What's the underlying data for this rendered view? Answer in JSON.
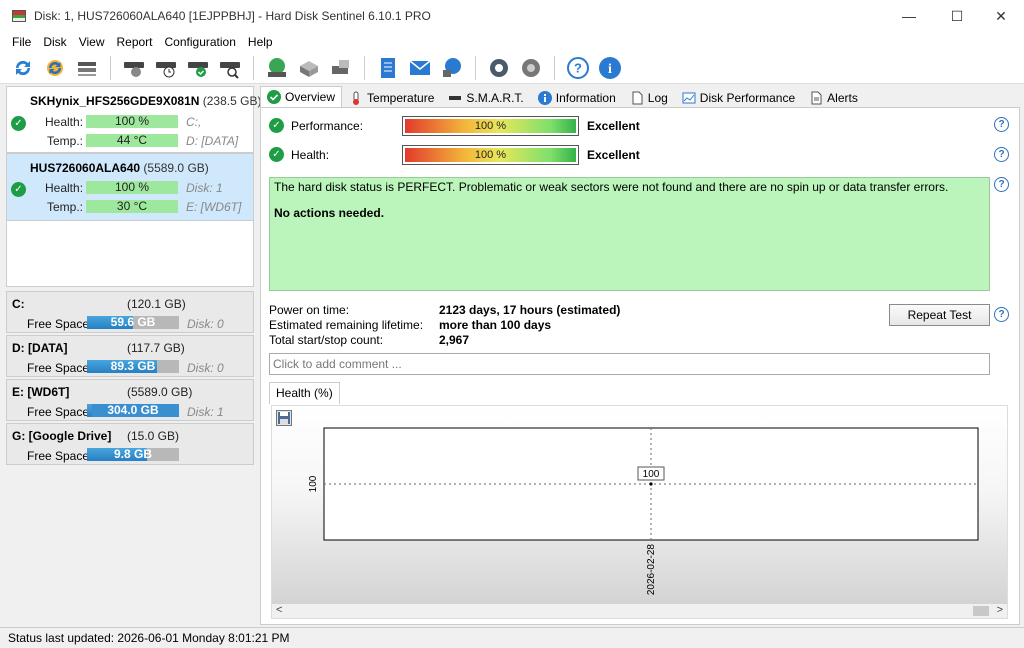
{
  "window": {
    "title": "Disk: 1, HUS726060ALA640 [1EJPPBHJ]  -  Hard Disk Sentinel 6.10.1 PRO",
    "minimize": "—",
    "maximize": "☐",
    "close": "✕"
  },
  "menu": [
    "File",
    "Disk",
    "View",
    "Report",
    "Configuration",
    "Help"
  ],
  "toolbar_icons": [
    "refresh-icon",
    "refresh-all-icon",
    "disk-list-icon",
    "disk-test-icon",
    "disk-timer-icon",
    "disk-check-icon",
    "disk-search-icon",
    "globe-disk-icon",
    "disk-tools-icon",
    "disk-config-icon",
    "report-icon",
    "email-icon",
    "network-icon",
    "settings-icon",
    "sound-icon",
    "help-icon",
    "info-icon"
  ],
  "disks": [
    {
      "name": "SKHynix_HFS256GDE9X081N",
      "size": "(238.5 GB)",
      "extra": "Di",
      "health_label": "Health:",
      "health": "100 %",
      "health_level": 1.0,
      "health_right": "C:,",
      "temp_label": "Temp.:",
      "temp": "44 °C",
      "temp_level": 1.0,
      "temp_right": "D: [DATA]"
    },
    {
      "name": "HUS726060ALA640",
      "size": "(5589.0 GB)",
      "extra": "",
      "health_label": "Health:",
      "health": "100 %",
      "health_level": 1.0,
      "health_right": "Disk: 1",
      "temp_label": "Temp.:",
      "temp": "30 °C",
      "temp_level": 1.0,
      "temp_right": "E: [WD6T]"
    }
  ],
  "volumes": [
    {
      "name": "C:",
      "size": "(120.1 GB)",
      "free_label": "Free Space",
      "free": "59.6 GB",
      "free_frac": 0.5,
      "disk": "Disk: 0"
    },
    {
      "name": "D: [DATA]",
      "size": "(117.7 GB)",
      "free_label": "Free Space",
      "free": "89.3 GB",
      "free_frac": 0.76,
      "disk": "Disk: 0"
    },
    {
      "name": "E: [WD6T]",
      "size": "(5589.0 GB)",
      "free_label": "Free Space",
      "free": "304.0 GB",
      "free_frac": 0.05,
      "disk": "Disk: 1"
    },
    {
      "name": "G: [Google Drive]",
      "size": "(15.0 GB)",
      "free_label": "Free Space",
      "free": "9.8 GB",
      "free_frac": 0.65,
      "disk": ""
    }
  ],
  "tabs": [
    "Overview",
    "Temperature",
    "S.M.A.R.T.",
    "Information",
    "Log",
    "Disk Performance",
    "Alerts"
  ],
  "overview": {
    "performance_label": "Performance:",
    "performance_pct": "100 %",
    "performance_level": 1.0,
    "performance_value": "Excellent",
    "health_label": "Health:",
    "health_pct": "100 %",
    "health_level": 1.0,
    "health_value": "Excellent",
    "status_message": "The hard disk status is PERFECT. Problematic or weak sectors were not found and there are no spin up or data transfer errors.",
    "status_action": "No actions needed.",
    "power_on_label": "Power on time:",
    "power_on_value": "2123 days, 17 hours (estimated)",
    "lifetime_label": "Estimated remaining lifetime:",
    "lifetime_value": "more than 100 days",
    "startstop_label": "Total start/stop count:",
    "startstop_value": "2,967",
    "repeat_button": "Repeat Test",
    "comment_placeholder": "Click to add comment ...",
    "help_glyph": "?",
    "health_tab": "Health (%)"
  },
  "chart_data": {
    "type": "line",
    "x": [
      "2026-02-28"
    ],
    "series": [
      {
        "values": [
          100
        ]
      }
    ],
    "ytick": "100",
    "xtick": "2026-02-28",
    "data_label": "100"
  },
  "scroll": {
    "left": "<",
    "right": ">"
  },
  "status_bar": "Status last updated: 2026-06-01 Monday 8:01:21 PM"
}
